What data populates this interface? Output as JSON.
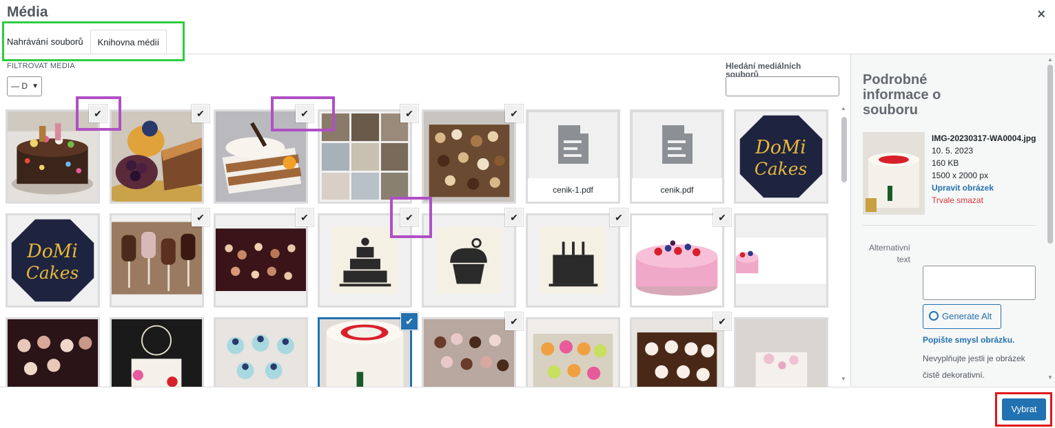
{
  "modal": {
    "title": "Média",
    "close_label": "×"
  },
  "tabs": [
    {
      "label": "Nahrávání souborů",
      "active": false
    },
    {
      "label": "Knihovna médií",
      "active": true
    }
  ],
  "filter": {
    "label": "FILTROVAT MEDIA",
    "selected": "— D"
  },
  "search": {
    "label": "Hledání mediálních souborů",
    "value": ""
  },
  "grid": {
    "items": [
      {
        "name": "chocolate-drip-cake",
        "checked": true
      },
      {
        "name": "dessert-tarts",
        "checked": true
      },
      {
        "name": "carrot-cake-slice",
        "checked": true
      },
      {
        "name": "photo-collage",
        "checked": true
      },
      {
        "name": "cookie-tray",
        "checked": true
      },
      {
        "name": "cenik-1.pdf",
        "label": "cenik-1.pdf",
        "type": "document",
        "checked": false
      },
      {
        "name": "cenik.pdf",
        "label": "cenik.pdf",
        "type": "document",
        "checked": false
      },
      {
        "name": "domi-cakes-logo",
        "checked": false
      },
      {
        "name": "domi-cakes-logo-2",
        "checked": false
      },
      {
        "name": "cake-pops",
        "checked": true
      },
      {
        "name": "dessert-table-night",
        "checked": true
      },
      {
        "name": "tiered-cake-icon",
        "checked": true
      },
      {
        "name": "cupcake-icon",
        "checked": true
      },
      {
        "name": "birthday-cake-icon",
        "checked": true
      },
      {
        "name": "berry-cake",
        "checked": true
      },
      {
        "name": "berry-cake-wide",
        "checked": false
      },
      {
        "name": "cupcake-display",
        "checked": false
      },
      {
        "name": "wedding-cake-topper",
        "checked": false
      },
      {
        "name": "blue-cupcakes",
        "checked": false
      },
      {
        "name": "selected-cake",
        "checked": true,
        "selected": true
      },
      {
        "name": "mini-desserts",
        "checked": true
      },
      {
        "name": "macarons-box",
        "checked": false
      },
      {
        "name": "heart-cupcakes",
        "checked": true
      },
      {
        "name": "pink-cake",
        "checked": false
      }
    ]
  },
  "details": {
    "heading": "Podrobné informace o souboru",
    "filename": "IMG-20230317-WA0004.jpg",
    "date": "10. 5. 2023",
    "size": "160 KB",
    "dimensions": "1500 x 2000 px",
    "edit_link": "Upravit obrázek",
    "delete_link": "Trvale smazat",
    "alt_label": "Alternativní text",
    "alt_value": "",
    "generate_alt": "Generate Alt",
    "describe_link": "Popište smysl obrázku.",
    "describe_hint": "Nevyplňujte jestli je obrázek čistě dekorativní."
  },
  "toolbar": {
    "select_label": "Vybrat"
  },
  "colors": {
    "accent": "#2271b1",
    "danger": "#d63638",
    "annotation_green": "#2ecc40",
    "annotation_purple": "#b04fc5",
    "annotation_red": "#e0161b"
  }
}
